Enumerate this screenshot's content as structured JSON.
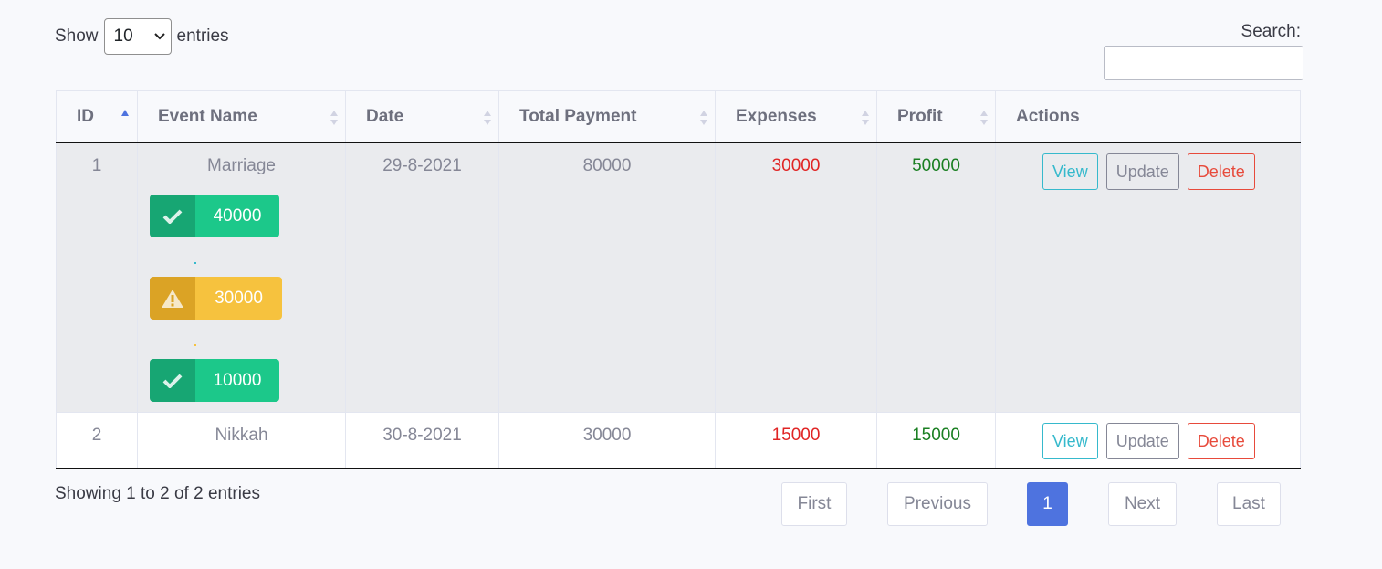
{
  "length_menu": {
    "show_label": "Show",
    "selected": "10",
    "entries_label": "entries"
  },
  "search": {
    "label": "Search:",
    "value": ""
  },
  "columns": [
    "ID",
    "Event Name",
    "Date",
    "Total Payment",
    "Expenses",
    "Profit",
    "Actions"
  ],
  "rows": [
    {
      "id": "1",
      "event": "Marriage",
      "date": "29-8-2021",
      "total": "80000",
      "expenses": "30000",
      "profit": "50000",
      "badges": [
        {
          "value": "40000",
          "status": "paid",
          "icon": "check-icon"
        },
        {
          "value": "30000",
          "status": "pending",
          "icon": "warning-icon"
        },
        {
          "value": "10000",
          "status": "paid",
          "icon": "check-icon"
        }
      ]
    },
    {
      "id": "2",
      "event": "Nikkah",
      "date": "30-8-2021",
      "total": "30000",
      "expenses": "15000",
      "profit": "15000",
      "badges": []
    }
  ],
  "actions": {
    "view": "View",
    "update": "Update",
    "delete": "Delete"
  },
  "info": "Showing 1 to 2 of 2 entries",
  "pagination": {
    "first": "First",
    "previous": "Previous",
    "current": "1",
    "next": "Next",
    "last": "Last"
  },
  "colors": {
    "primary": "#4e73df",
    "success": "#1cc88a",
    "warning": "#f6c23e",
    "danger": "#e74a3b",
    "info": "#36b9cc",
    "expense_text": "#e02424",
    "profit_text": "#1a7f22"
  }
}
